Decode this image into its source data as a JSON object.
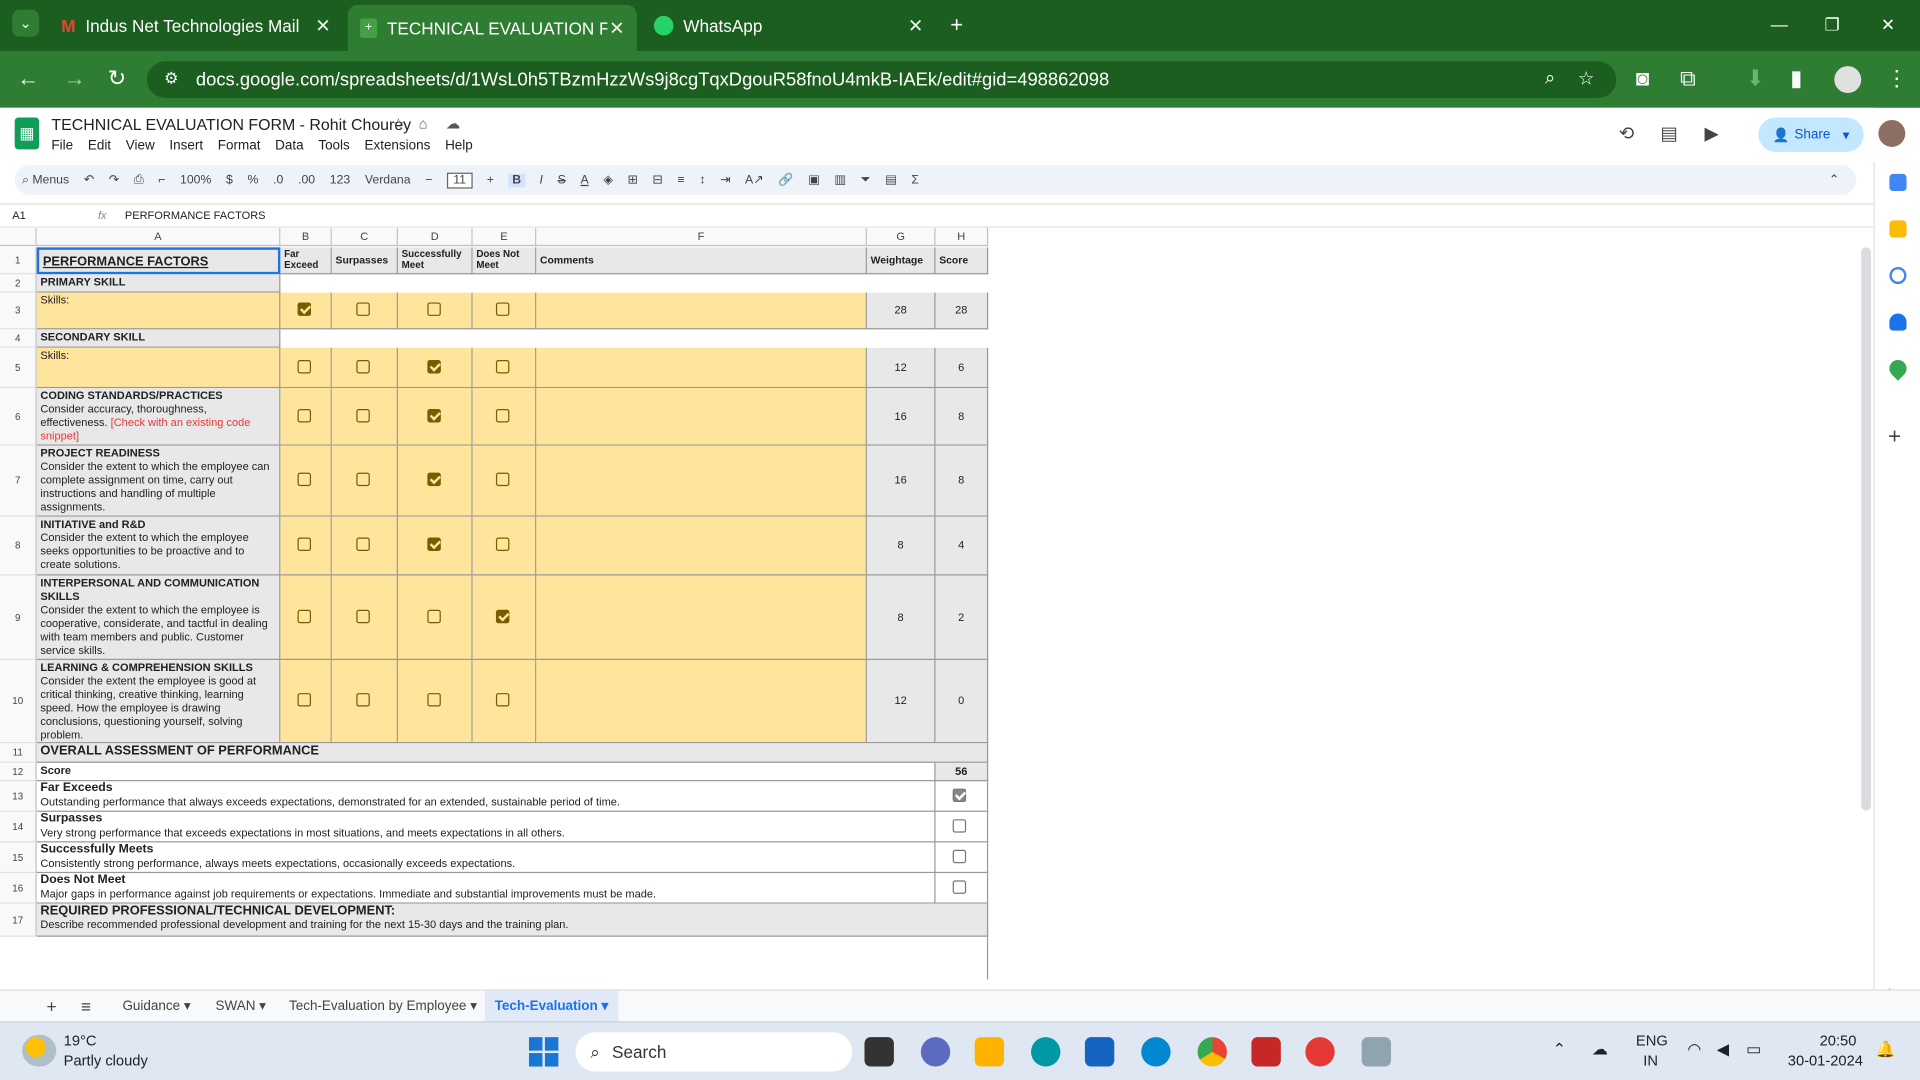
{
  "browser": {
    "tabs": [
      {
        "label": "Indus Net Technologies Mail",
        "icon": "gmail-icon"
      },
      {
        "label": "TECHNICAL EVALUATION FORM",
        "icon": "sheets-icon"
      },
      {
        "label": "WhatsApp",
        "icon": "whatsapp-icon"
      }
    ],
    "url": "docs.google.com/spreadsheets/d/1WsL0h5TBzmHzzWs9j8cgTqxDgouR58fnoU4mkB-IAEk/edit#gid=498862098"
  },
  "doc": {
    "title": "TECHNICAL EVALUATION FORM - Rohit Chourey",
    "menu": [
      "File",
      "Edit",
      "View",
      "Insert",
      "Format",
      "Data",
      "Tools",
      "Extensions",
      "Help"
    ],
    "share_label": "Share"
  },
  "toolbar": {
    "menus_label": "Menus",
    "zoom": "100%",
    "currency": "$",
    "percent": "%",
    "dec_dec": ".0",
    "dec_inc": ".00",
    "format_num": "123",
    "font": "Verdana",
    "font_size": "11"
  },
  "formula_bar": {
    "cell_ref": "A1",
    "fx": "fx",
    "content": "PERFORMANCE FACTORS"
  },
  "columns": [
    "A",
    "B",
    "C",
    "D",
    "E",
    "F",
    "G",
    "H"
  ],
  "row_numbers": [
    "1",
    "2",
    "3",
    "4",
    "5",
    "6",
    "7",
    "8",
    "9",
    "10",
    "11",
    "12",
    "13",
    "14",
    "15",
    "16",
    "17"
  ],
  "header_row": {
    "a": "PERFORMANCE FACTORS",
    "b": "Far Exceed",
    "c": "Surpasses",
    "d": "Successfully Meet",
    "e": "Does Not Meet",
    "f": "Comments",
    "g": "Weightage",
    "h": "Score"
  },
  "sections": {
    "primary": "PRIMARY SKILL",
    "primary_sub": "Skills:",
    "secondary": "SECONDARY SKILL",
    "secondary_sub": "Skills:"
  },
  "factors": [
    {
      "title": "CODING STANDARDS/PRACTICES",
      "desc": "Consider accuracy, thoroughness, effectiveness. ",
      "note": "[Check with an existing code snippet]"
    },
    {
      "title": "PROJECT READINESS",
      "desc": "Consider the extent to which the employee can complete assignment on time, carry out instructions and handling of multiple assignments."
    },
    {
      "title": "INITIATIVE and R&D",
      "desc": "Consider the extent to which the employee seeks opportunities to be proactive and to create solutions."
    },
    {
      "title": "INTERPERSONAL AND COMMUNICATION SKILLS",
      "desc": "Consider the extent to which the employee is cooperative, considerate, and tactful in dealing with team members and public. Customer service skills."
    },
    {
      "title": "LEARNING & COMPREHENSION SKILLS",
      "desc": "Consider the extent the employee is good at critical thinking, creative thinking, learning speed. How the employee is drawing conclusions, questioning yourself, solving problem."
    }
  ],
  "ratings": [
    {
      "checked": 0,
      "weight": "28",
      "score": "28"
    },
    {
      "checked": 2,
      "weight": "12",
      "score": "6"
    },
    {
      "checked": 2,
      "weight": "16",
      "score": "8"
    },
    {
      "checked": 2,
      "weight": "16",
      "score": "8"
    },
    {
      "checked": 2,
      "weight": "8",
      "score": "4"
    },
    {
      "checked": 3,
      "weight": "8",
      "score": "2"
    },
    {
      "checked": -1,
      "weight": "12",
      "score": "0"
    }
  ],
  "overall": {
    "title": "OVERALL ASSESSMENT OF PERFORMANCE",
    "score_label": "Score",
    "score_value": "56",
    "levels": [
      {
        "title": "Far Exceeds",
        "desc": "Outstanding performance that always exceeds expectations, demonstrated for an extended, sustainable period of time.",
        "checked": true
      },
      {
        "title": "Surpasses",
        "desc": "Very strong performance that exceeds expectations in most situations, and meets expectations in all others.",
        "checked": false
      },
      {
        "title": "Successfully Meets",
        "desc": "Consistently strong performance, always meets expectations, occasionally exceeds expectations.",
        "checked": false
      },
      {
        "title": "Does Not Meet",
        "desc": "Major gaps in performance against job requirements or expectations. Immediate and substantial improvements must be made.",
        "checked": false
      }
    ],
    "dev_title": "REQUIRED PROFESSIONAL/TECHNICAL DEVELOPMENT:",
    "dev_desc": "Describe recommended professional development and training for the next 15-30 days and the training plan."
  },
  "sheet_tabs": [
    "Guidance",
    "SWAN",
    "Tech-Evaluation by Employee",
    "Tech-Evaluation"
  ],
  "taskbar": {
    "temp": "19°C",
    "weather": "Partly cloudy",
    "search": "Search",
    "lang1": "ENG",
    "lang2": "IN",
    "time": "20:50",
    "date": "30-01-2024"
  },
  "colors": {
    "accent": "#1a73e8",
    "chrome_green": "#2e7d32",
    "cell_yellow": "#ffe49b",
    "checkbox": "#7a5c00"
  }
}
